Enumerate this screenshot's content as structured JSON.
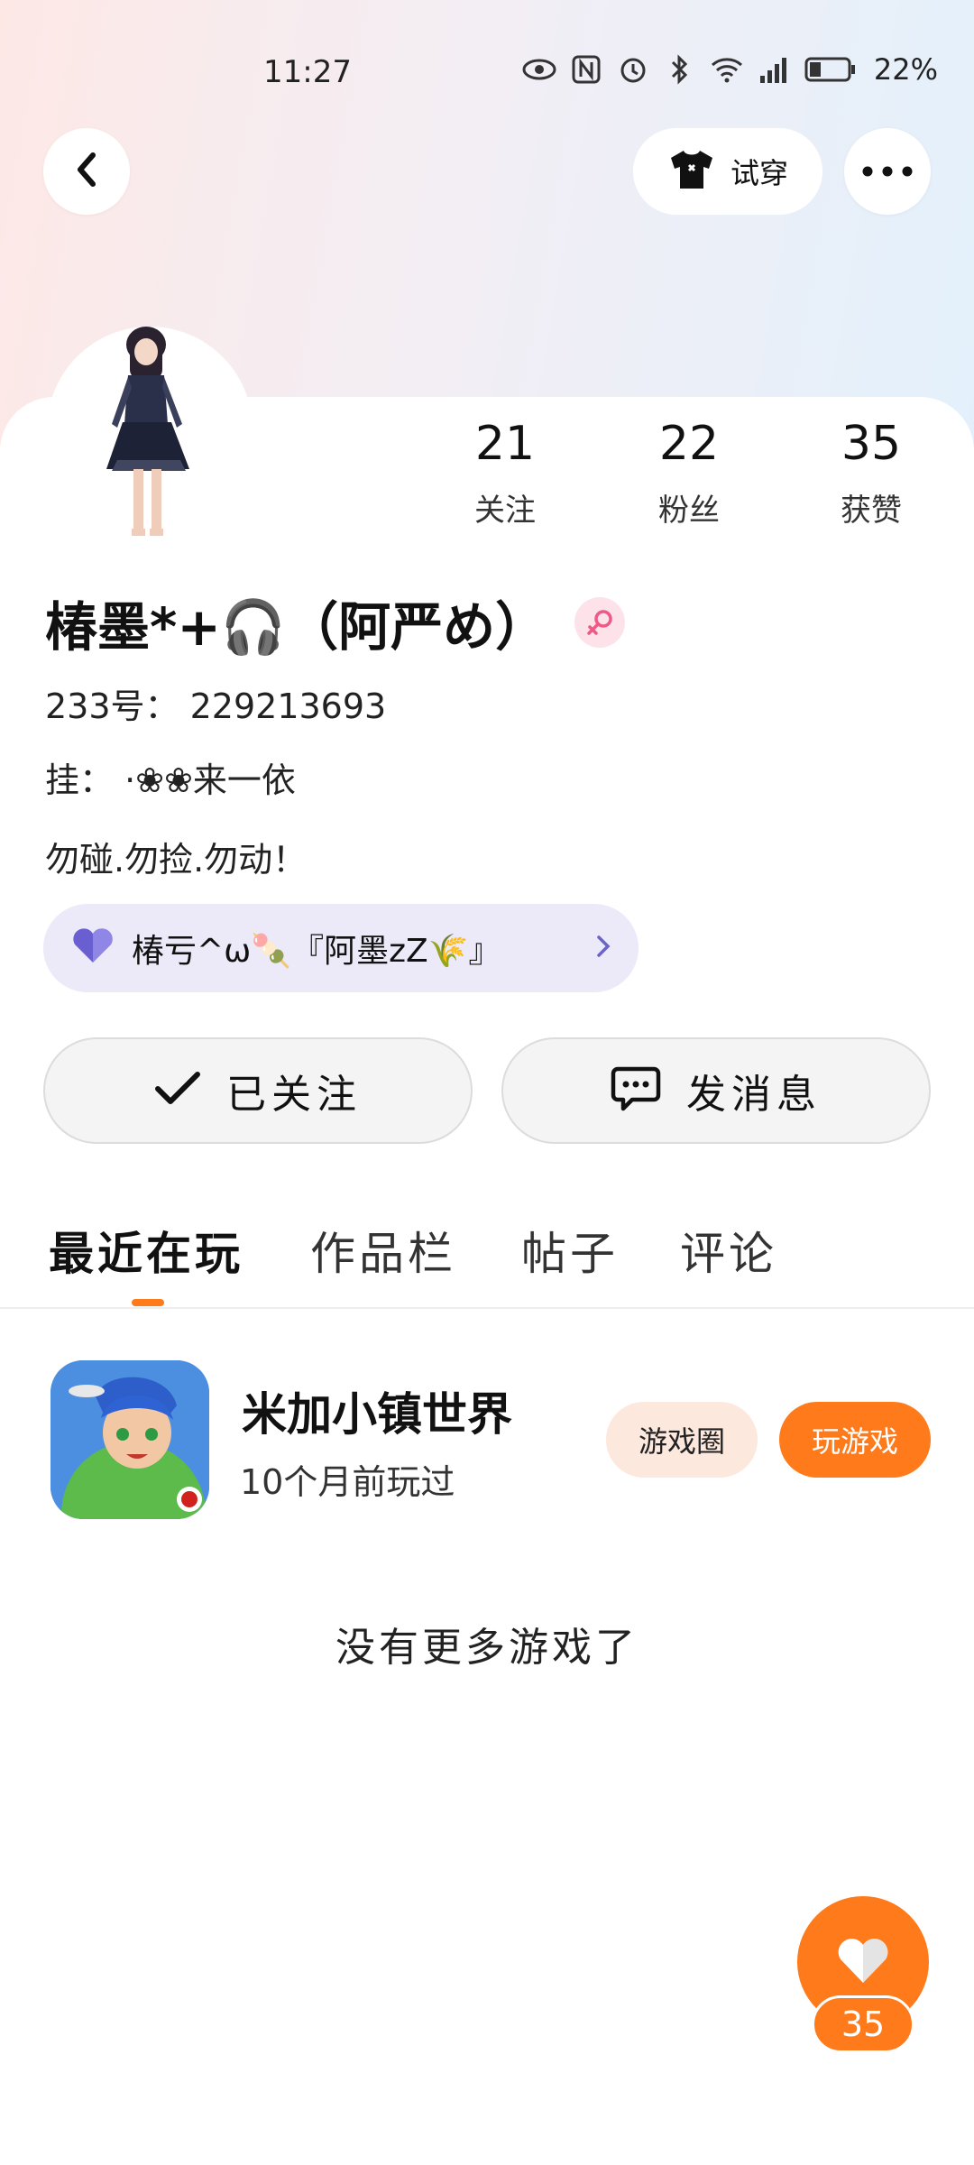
{
  "status_bar": {
    "time": "11:27",
    "battery_percent": "22%",
    "icons": [
      "eye-icon",
      "nfc-icon",
      "alarm-icon",
      "bluetooth-icon",
      "wifi-icon",
      "signal-icon",
      "battery-icon"
    ]
  },
  "header": {
    "tryon_label": "试穿"
  },
  "stats": [
    {
      "value": "21",
      "label": "关注"
    },
    {
      "value": "22",
      "label": "粉丝"
    },
    {
      "value": "35",
      "label": "获赞"
    }
  ],
  "profile": {
    "username": "椿墨*+🎧（阿严め）",
    "id_line": "233号： 229213693",
    "tag_line": "挂： ·❀❀来一依",
    "bio": "勿碰.勿捡.勿动！",
    "guild_text": "椿亏^ω🍡『阿墨zZ🌾』"
  },
  "actions": {
    "following_label": "已关注",
    "message_label": "发消息"
  },
  "tabs": [
    "最近在玩",
    "作品栏",
    "帖子",
    "评论"
  ],
  "game": {
    "title": "米加小镇世界",
    "subtitle": "10个月前玩过",
    "circle_label": "游戏圈",
    "play_label": "玩游戏"
  },
  "no_more_text": "没有更多游戏了",
  "fab": {
    "count": "35"
  },
  "colors": {
    "accent": "#ff7a1a",
    "guild_pill": "#eceaf8",
    "gender_bg": "#fde2ea"
  }
}
